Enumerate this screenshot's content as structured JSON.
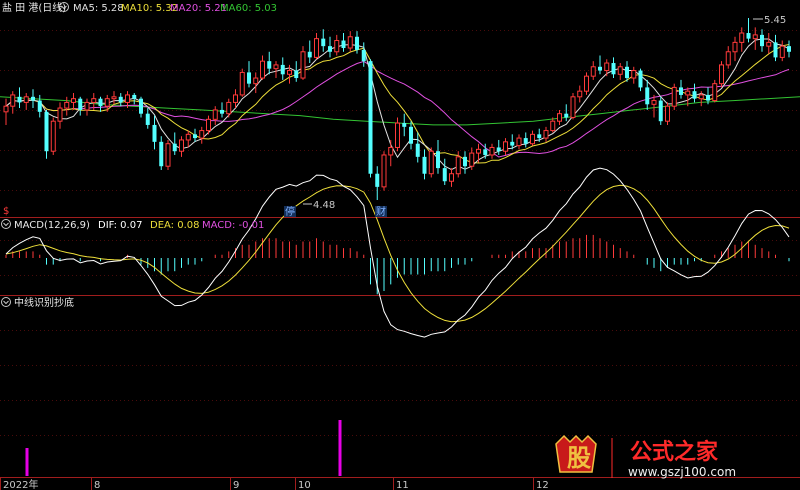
{
  "colors": {
    "background": "#000000",
    "separator": "#a01d1d",
    "grid": "#4a0b0b",
    "up": "#ff3a3a",
    "down": "#54ffff",
    "ma5": "#e0e0e0",
    "ma10": "#eedf3a",
    "ma20": "#e050e0",
    "ma60": "#33c433",
    "dif": "#ffffff",
    "dea": "#eedf3a",
    "macd_pos": "#ff3a3a",
    "macd_neg": "#54ffff",
    "signal": "#e600e6",
    "label_gray": "#c8c8c8",
    "marker_blue": "#3a7fff",
    "watermark_red": "#ff2a2a",
    "watermark_gold": "#f0c040"
  },
  "price_panel": {
    "stock_name": "盐 田 港(日线)",
    "ma5": "MA5: 5.28",
    "ma10": "MA10: 5.32",
    "ma20": "MA20: 5.21",
    "ma60": "MA60: 5.03",
    "high_label": "5.45",
    "low_label": "4.48",
    "marker_ting": "停",
    "marker_cai": "财",
    "left_marker": "$"
  },
  "macd_panel": {
    "title": "MACD(12,26,9)",
    "dif": "DIF: 0.07",
    "dea": "DEA: 0.08",
    "macd": "MACD: -0.01"
  },
  "indicator_panel": {
    "title": "中线识别抄底"
  },
  "x_axis": {
    "labels": [
      "2022年",
      "8",
      "9",
      "10",
      "11",
      "12"
    ]
  },
  "watermark": {
    "badge": "股",
    "title": "公式之家",
    "url": "www.gszj100.com"
  },
  "chart_data": {
    "type": "candlestick",
    "title": "盐 田 港(日线)",
    "x_labels": [
      "2022年",
      "8",
      "9",
      "10",
      "11",
      "12"
    ],
    "candles": [
      [
        4.95,
        5.02,
        4.88,
        4.98
      ],
      [
        4.98,
        5.06,
        4.94,
        5.04
      ],
      [
        5.03,
        5.08,
        4.97,
        5.0
      ],
      [
        5.0,
        5.05,
        4.96,
        5.03
      ],
      [
        5.03,
        5.07,
        4.97,
        5.01
      ],
      [
        5.01,
        5.04,
        4.92,
        4.95
      ],
      [
        4.95,
        4.96,
        4.7,
        4.74
      ],
      [
        4.74,
        4.92,
        4.72,
        4.9
      ],
      [
        4.9,
        5.0,
        4.86,
        4.97
      ],
      [
        4.97,
        5.03,
        4.93,
        5.0
      ],
      [
        5.0,
        5.05,
        4.96,
        5.02
      ],
      [
        5.02,
        5.03,
        4.93,
        4.96
      ],
      [
        4.96,
        5.02,
        4.93,
        5.0
      ],
      [
        5.0,
        5.05,
        4.96,
        5.02
      ],
      [
        5.02,
        5.03,
        4.95,
        4.98
      ],
      [
        4.98,
        5.04,
        4.95,
        5.02
      ],
      [
        5.02,
        5.06,
        4.99,
        5.03
      ],
      [
        5.03,
        5.05,
        4.98,
        5.0
      ],
      [
        5.0,
        5.06,
        4.97,
        5.04
      ],
      [
        5.04,
        5.05,
        4.99,
        5.02
      ],
      [
        5.02,
        5.03,
        4.92,
        4.94
      ],
      [
        4.94,
        4.97,
        4.86,
        4.88
      ],
      [
        4.88,
        4.93,
        4.75,
        4.79
      ],
      [
        4.79,
        4.82,
        4.64,
        4.66
      ],
      [
        4.66,
        4.8,
        4.64,
        4.78
      ],
      [
        4.78,
        4.84,
        4.72,
        4.74
      ],
      [
        4.74,
        4.82,
        4.71,
        4.8
      ],
      [
        4.8,
        4.85,
        4.76,
        4.83
      ],
      [
        4.83,
        4.86,
        4.79,
        4.81
      ],
      [
        4.81,
        4.87,
        4.78,
        4.85
      ],
      [
        4.85,
        4.93,
        4.83,
        4.91
      ],
      [
        4.91,
        4.98,
        4.88,
        4.96
      ],
      [
        4.96,
        5.0,
        4.92,
        4.94
      ],
      [
        4.94,
        5.02,
        4.92,
        5.0
      ],
      [
        5.0,
        5.07,
        4.97,
        5.04
      ],
      [
        5.04,
        5.18,
        5.03,
        5.16
      ],
      [
        5.16,
        5.22,
        5.08,
        5.1
      ],
      [
        5.1,
        5.16,
        5.05,
        5.13
      ],
      [
        5.13,
        5.25,
        5.12,
        5.22
      ],
      [
        5.22,
        5.27,
        5.15,
        5.18
      ],
      [
        5.18,
        5.22,
        5.13,
        5.2
      ],
      [
        5.2,
        5.24,
        5.12,
        5.15
      ],
      [
        5.15,
        5.2,
        5.1,
        5.17
      ],
      [
        5.17,
        5.22,
        5.11,
        5.13
      ],
      [
        5.13,
        5.3,
        5.12,
        5.27
      ],
      [
        5.27,
        5.33,
        5.21,
        5.24
      ],
      [
        5.24,
        5.37,
        5.23,
        5.34
      ],
      [
        5.34,
        5.39,
        5.27,
        5.3
      ],
      [
        5.3,
        5.35,
        5.24,
        5.27
      ],
      [
        5.27,
        5.36,
        5.25,
        5.33
      ],
      [
        5.33,
        5.37,
        5.27,
        5.29
      ],
      [
        5.29,
        5.38,
        5.27,
        5.35
      ],
      [
        5.35,
        5.38,
        5.26,
        5.28
      ],
      [
        5.28,
        5.32,
        5.19,
        5.22
      ],
      [
        5.22,
        5.23,
        4.6,
        4.62
      ],
      [
        4.62,
        4.66,
        4.48,
        4.55
      ],
      [
        4.55,
        4.74,
        4.53,
        4.72
      ],
      [
        4.72,
        4.8,
        4.66,
        4.76
      ],
      [
        4.76,
        4.92,
        4.74,
        4.89
      ],
      [
        4.89,
        4.94,
        4.82,
        4.87
      ],
      [
        4.87,
        4.9,
        4.75,
        4.78
      ],
      [
        4.78,
        4.84,
        4.68,
        4.71
      ],
      [
        4.71,
        4.75,
        4.59,
        4.62
      ],
      [
        4.62,
        4.76,
        4.6,
        4.74
      ],
      [
        4.74,
        4.8,
        4.62,
        4.65
      ],
      [
        4.65,
        4.7,
        4.56,
        4.58
      ],
      [
        4.58,
        4.65,
        4.55,
        4.62
      ],
      [
        4.62,
        4.74,
        4.6,
        4.71
      ],
      [
        4.71,
        4.74,
        4.62,
        4.66
      ],
      [
        4.66,
        4.76,
        4.64,
        4.73
      ],
      [
        4.73,
        4.78,
        4.68,
        4.75
      ],
      [
        4.75,
        4.78,
        4.7,
        4.72
      ],
      [
        4.72,
        4.78,
        4.7,
        4.76
      ],
      [
        4.76,
        4.8,
        4.72,
        4.74
      ],
      [
        4.74,
        4.81,
        4.72,
        4.79
      ],
      [
        4.79,
        4.83,
        4.75,
        4.77
      ],
      [
        4.77,
        4.83,
        4.75,
        4.81
      ],
      [
        4.81,
        4.84,
        4.76,
        4.78
      ],
      [
        4.78,
        4.85,
        4.77,
        4.83
      ],
      [
        4.83,
        4.86,
        4.79,
        4.81
      ],
      [
        4.81,
        4.87,
        4.79,
        4.85
      ],
      [
        4.85,
        4.92,
        4.84,
        4.9
      ],
      [
        4.9,
        4.96,
        4.88,
        4.94
      ],
      [
        4.94,
        4.99,
        4.9,
        4.92
      ],
      [
        4.92,
        5.05,
        4.91,
        5.03
      ],
      [
        5.03,
        5.09,
        5.0,
        5.06
      ],
      [
        5.06,
        5.16,
        5.04,
        5.14
      ],
      [
        5.14,
        5.22,
        5.12,
        5.19
      ],
      [
        5.19,
        5.25,
        5.15,
        5.17
      ],
      [
        5.17,
        5.23,
        5.14,
        5.21
      ],
      [
        5.21,
        5.24,
        5.13,
        5.15
      ],
      [
        5.15,
        5.21,
        5.12,
        5.19
      ],
      [
        5.19,
        5.22,
        5.11,
        5.13
      ],
      [
        5.13,
        5.19,
        5.1,
        5.17
      ],
      [
        5.17,
        5.18,
        5.06,
        5.08
      ],
      [
        5.08,
        5.12,
        4.96,
        4.99
      ],
      [
        4.99,
        5.04,
        4.92,
        5.01
      ],
      [
        5.01,
        5.03,
        4.88,
        4.9
      ],
      [
        4.9,
        5.0,
        4.88,
        4.98
      ],
      [
        4.98,
        5.1,
        4.96,
        5.08
      ],
      [
        5.08,
        5.12,
        5.02,
        5.04
      ],
      [
        5.04,
        5.08,
        4.98,
        5.06
      ],
      [
        5.06,
        5.1,
        5.0,
        5.02
      ],
      [
        5.02,
        5.06,
        4.98,
        5.04
      ],
      [
        5.04,
        5.08,
        4.99,
        5.01
      ],
      [
        5.01,
        5.12,
        5.0,
        5.1
      ],
      [
        5.1,
        5.22,
        5.08,
        5.2
      ],
      [
        5.2,
        5.3,
        5.18,
        5.27
      ],
      [
        5.27,
        5.35,
        5.22,
        5.32
      ],
      [
        5.32,
        5.4,
        5.27,
        5.37
      ],
      [
        5.37,
        5.45,
        5.32,
        5.34
      ],
      [
        5.34,
        5.4,
        5.28,
        5.36
      ],
      [
        5.36,
        5.39,
        5.27,
        5.3
      ],
      [
        5.3,
        5.37,
        5.26,
        5.32
      ],
      [
        5.32,
        5.36,
        5.22,
        5.24
      ],
      [
        5.24,
        5.33,
        5.22,
        5.3
      ],
      [
        5.3,
        5.33,
        5.24,
        5.27
      ]
    ],
    "price_range": [
      4.48,
      5.45
    ],
    "ma_periods": [
      5,
      10,
      20,
      60
    ],
    "ma60_curve": [
      5.03,
      5.02,
      5.01,
      4.99,
      4.98,
      4.97,
      4.96,
      4.95,
      4.94,
      4.93,
      4.91,
      4.9,
      4.89,
      4.88,
      4.88,
      4.89,
      4.9,
      4.92,
      4.94,
      4.96,
      4.98,
      5.0,
      5.01,
      5.02,
      5.03
    ],
    "macd": {
      "histogram": [
        0.01,
        0.02,
        0.02,
        0.02,
        0.02,
        0.01,
        -0.02,
        -0.02,
        -0.01,
        0.0,
        0.0,
        -0.01,
        0.0,
        0.0,
        -0.01,
        0.0,
        0.0,
        0.0,
        0.01,
        0.0,
        -0.02,
        -0.03,
        -0.04,
        -0.05,
        -0.04,
        -0.04,
        -0.03,
        -0.02,
        -0.02,
        -0.01,
        0.0,
        0.01,
        0.01,
        0.02,
        0.03,
        0.04,
        0.04,
        0.05,
        0.06,
        0.06,
        0.06,
        0.05,
        0.05,
        0.04,
        0.05,
        0.05,
        0.06,
        0.05,
        0.04,
        0.04,
        0.03,
        0.03,
        0.02,
        0.01,
        -0.08,
        -0.11,
        -0.1,
        -0.08,
        -0.06,
        -0.05,
        -0.05,
        -0.05,
        -0.05,
        -0.04,
        -0.04,
        -0.04,
        -0.03,
        -0.02,
        -0.02,
        -0.01,
        0.0,
        0.0,
        0.01,
        0.01,
        0.01,
        0.02,
        0.02,
        0.02,
        0.03,
        0.03,
        0.03,
        0.04,
        0.05,
        0.05,
        0.06,
        0.06,
        0.07,
        0.07,
        0.06,
        0.05,
        0.04,
        0.03,
        0.02,
        0.01,
        0.0,
        -0.02,
        -0.03,
        -0.04,
        -0.03,
        -0.02,
        -0.02,
        -0.02,
        -0.01,
        -0.01,
        0.0,
        0.01,
        0.02,
        0.03,
        0.04,
        0.05,
        0.05,
        0.04,
        0.03,
        0.02,
        0.01,
        0.0,
        -0.01
      ],
      "dif_last": 0.07,
      "dea_last": 0.08,
      "macd_last": -0.01
    },
    "signal_bars": [
      {
        "candle_index": 5,
        "value": 1.0
      },
      {
        "candle_index": 70,
        "value": 2.0
      }
    ]
  }
}
